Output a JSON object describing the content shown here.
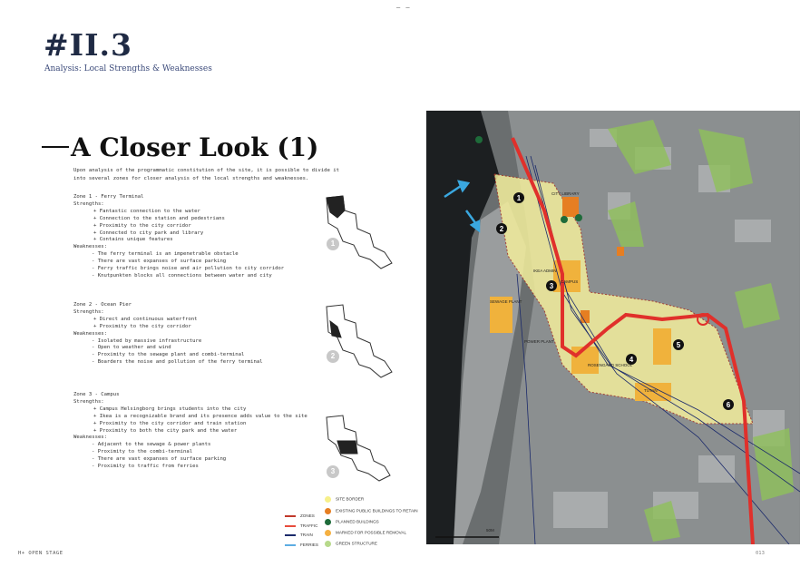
{
  "header": {
    "top_mark": "— —",
    "section_number": "#II.3",
    "section_subtitle": "Analysis:  Local Strengths & Weaknesses"
  },
  "title": "A Closer Look (1)",
  "intro": "Upon analysis of the programmatic constitution of the site, it is possible to divide it into several zones for closer analysis of the local strengths and weaknesses.",
  "zones": [
    {
      "heading": "Zone 1 - Ferry Terminal",
      "strengths_label": "Strengths:",
      "strengths": [
        "+ Fantastic connection to the water",
        "+ Connection to the station and pedestrians",
        "+ Proximity to the city corridor",
        "+ Connected to city park and library",
        "+ Contains unique features"
      ],
      "weaknesses_label": "Weaknesses:",
      "weaknesses": [
        "- The ferry terminal is an impenetrable obstacle",
        "- There are vast expanses of surface parking",
        "- Ferry traffic brings noise and air pollution to city corridor",
        "- Knutpunkten blocks all connections between water and city"
      ],
      "badge": "1"
    },
    {
      "heading": "Zone 2 - Ocean Pier",
      "strengths_label": "Strengths:",
      "strengths": [
        "+ Direct and continuous waterfront",
        "+ Proximity to the city corridor"
      ],
      "weaknesses_label": "Weaknesses:",
      "weaknesses": [
        "- Isolated by massive infrastructure",
        "- Open to weather and wind",
        "- Proximity to the sewage plant and combi-terminal",
        "- Boarders the noise and pollution of the ferry terminal"
      ],
      "badge": "2"
    },
    {
      "heading": "Zone 3 - Campus",
      "strengths_label": "Strengths:",
      "strengths": [
        "+ Campus Helsingborg brings students into the city",
        "+ Ikea is a recognizable brand and its presence adds value to the site",
        "+ Proximity to the city corridor and train station",
        "+ Proximity to both the city park and the water"
      ],
      "weaknesses_label": "Weaknesses:",
      "weaknesses": [
        "- Adjacent to the sewage & power plants",
        "- Proximity to the combi-terminal",
        "- There are vast expanses of surface parking",
        "- Proximity to traffic from ferries"
      ],
      "badge": "3"
    }
  ],
  "map": {
    "markers": [
      "1",
      "2",
      "3",
      "4",
      "5",
      "6"
    ],
    "labels": {
      "city_library": "CITY LIBRARY",
      "sewage_plant": "SEWAGE PLANT",
      "ikea_admin": "IKEA ADMIN",
      "campus": "CAMPUS",
      "power_plant": "POWER PLANT",
      "rosengard_school": "ROSENGÅRD SCHOOL",
      "tutan": "TUTAN",
      "scale": "50M"
    }
  },
  "legend": {
    "lines": [
      {
        "label": "ZONES",
        "color": "#c0392b"
      },
      {
        "label": "TRAFFIC",
        "color": "#e74c3c"
      },
      {
        "label": "TRAIN",
        "color": "#1b2a6b"
      },
      {
        "label": "FERRIES",
        "color": "#5dade2"
      }
    ],
    "dots": [
      {
        "label": "SITE BORDER",
        "color": "#f7f08a"
      },
      {
        "label": "EXISTING PUBLIC BUILDINGS TO RETAIN",
        "color": "#e67e22"
      },
      {
        "label": "PLANNED BUILDINGS",
        "color": "#1e6b3a"
      },
      {
        "label": "MARKED FOR POSSIBLE REMOVAL",
        "color": "#f5b041"
      },
      {
        "label": "GREEN STRUCTURE",
        "color": "#b7d98b"
      }
    ]
  },
  "footer": {
    "left": "H+ OPEN STAGE",
    "right": "013"
  }
}
